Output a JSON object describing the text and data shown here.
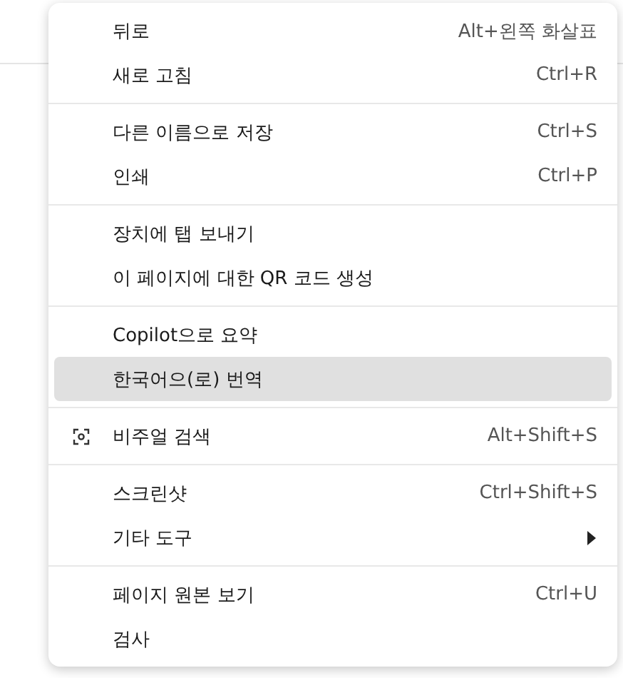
{
  "menu": {
    "groups": [
      {
        "items": [
          {
            "kind": "plain",
            "label": "뒤로",
            "shortcut": "Alt+왼쪽 화살표",
            "selected": false
          },
          {
            "kind": "plain",
            "label": "새로 고침",
            "shortcut": "Ctrl+R",
            "selected": false
          }
        ]
      },
      {
        "items": [
          {
            "kind": "plain",
            "label": "다른 이름으로 저장",
            "shortcut": "Ctrl+S",
            "selected": false
          },
          {
            "kind": "plain",
            "label": "인쇄",
            "shortcut": "Ctrl+P",
            "selected": false
          }
        ]
      },
      {
        "items": [
          {
            "kind": "plain",
            "label": "장치에 탭 보내기",
            "selected": false
          },
          {
            "kind": "plain",
            "label": "이 페이지에 대한 QR 코드 생성",
            "selected": false
          }
        ]
      },
      {
        "items": [
          {
            "kind": "plain",
            "label": "Copilot으로 요약",
            "selected": false
          },
          {
            "kind": "plain",
            "label": "한국어으(로) 번역",
            "selected": true
          }
        ]
      },
      {
        "items": [
          {
            "kind": "icon",
            "label": "비주얼 검색",
            "shortcut": "Alt+Shift+S",
            "selected": false
          }
        ]
      },
      {
        "items": [
          {
            "kind": "plain",
            "label": "스크린샷",
            "shortcut": "Ctrl+Shift+S",
            "selected": false
          },
          {
            "kind": "submenu",
            "label": "기타 도구",
            "selected": false
          }
        ]
      },
      {
        "items": [
          {
            "kind": "plain",
            "label": "페이지 원본 보기",
            "shortcut": "Ctrl+U",
            "selected": false
          },
          {
            "kind": "plain",
            "label": "검사",
            "selected": false
          }
        ]
      }
    ]
  }
}
